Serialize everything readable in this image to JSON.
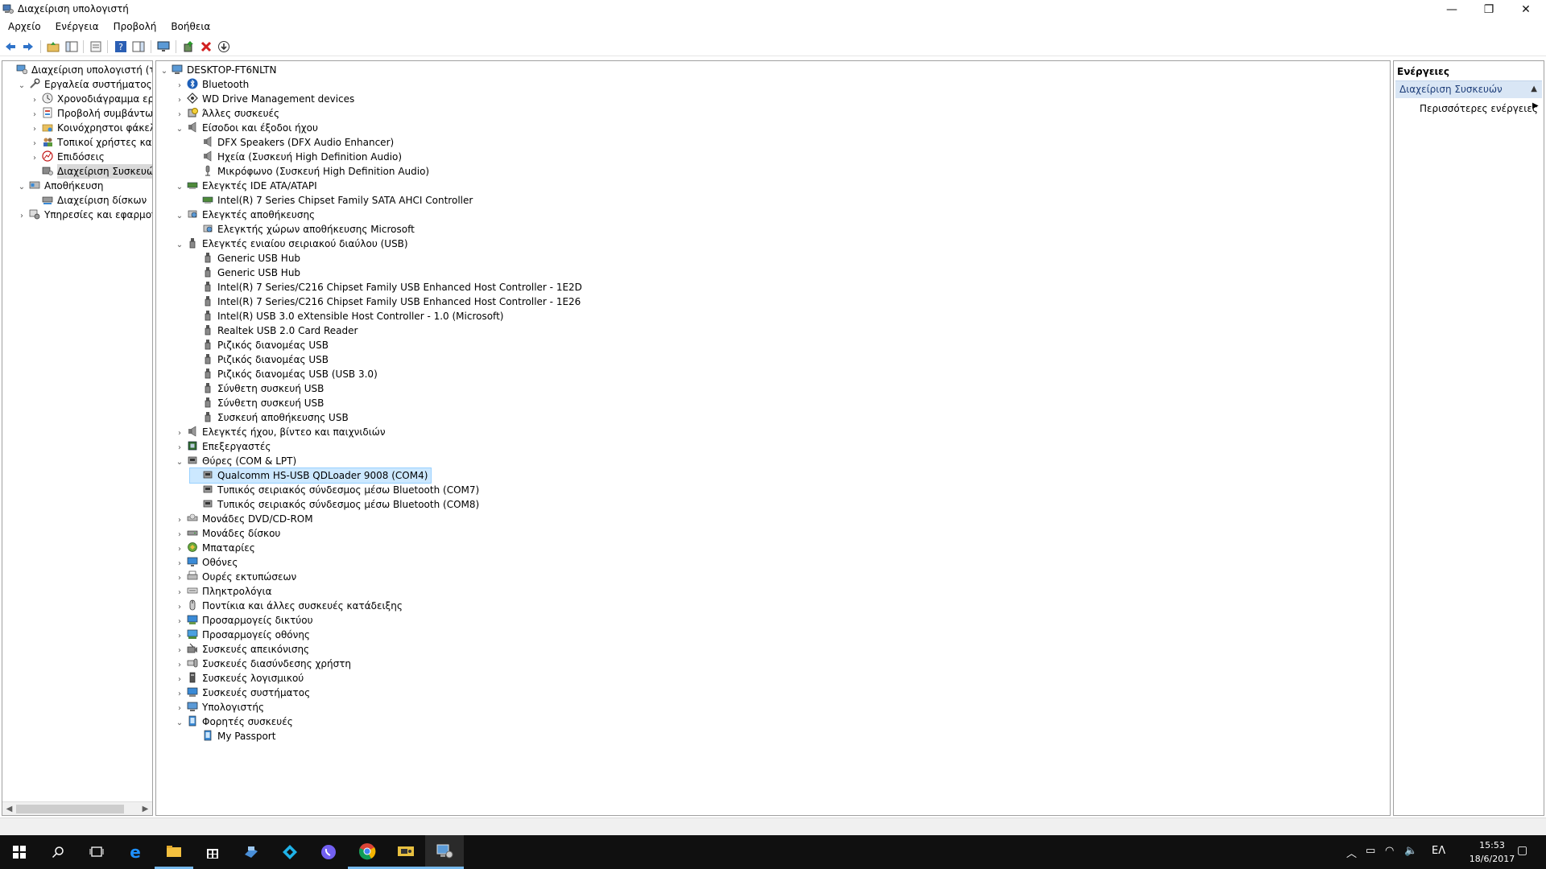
{
  "window": {
    "title": "Διαχείριση υπολογιστή",
    "minimize_glyph": "—",
    "maximize_glyph": "❐",
    "close_glyph": "✕"
  },
  "menu": [
    "Αρχείο",
    "Ενέργεια",
    "Προβολή",
    "Βοήθεια"
  ],
  "toolbar": {
    "icons": [
      "back-arrow-icon",
      "forward-arrow-icon",
      "folder-up-icon",
      "show-hide-tree-icon",
      "properties-icon",
      "help-icon",
      "action-pane-icon",
      "monitor-scan-icon",
      "update-driver-icon",
      "uninstall-icon",
      "download-icon"
    ]
  },
  "left_tree": {
    "items": [
      {
        "label": "Διαχείριση υπολογιστή (τοπικός)",
        "icon": "computer-management-icon",
        "indent": 0,
        "exp": ""
      },
      {
        "label": "Εργαλεία συστήματος",
        "icon": "tools-icon",
        "indent": 1,
        "exp": "v"
      },
      {
        "label": "Χρονοδιάγραμμα εργασιών",
        "icon": "clock-icon",
        "indent": 2,
        "exp": ">"
      },
      {
        "label": "Προβολή συμβάντων",
        "icon": "event-viewer-icon",
        "indent": 2,
        "exp": ">"
      },
      {
        "label": "Κοινόχρηστοι φάκελοι",
        "icon": "shared-folder-icon",
        "indent": 2,
        "exp": ">"
      },
      {
        "label": "Τοπικοί χρήστες και ομάδες",
        "icon": "users-icon",
        "indent": 2,
        "exp": ">"
      },
      {
        "label": "Επιδόσεις",
        "icon": "performance-icon",
        "indent": 2,
        "exp": ">"
      },
      {
        "label": "Διαχείριση Συσκευών",
        "icon": "device-manager-icon",
        "indent": 2,
        "exp": ""
      },
      {
        "label": "Αποθήκευση",
        "icon": "storage-icon",
        "indent": 1,
        "exp": "v"
      },
      {
        "label": "Διαχείριση δίσκων",
        "icon": "disk-management-icon",
        "indent": 2,
        "exp": ""
      },
      {
        "label": "Υπηρεσίες και εφαρμογές",
        "icon": "services-icon",
        "indent": 1,
        "exp": ">"
      }
    ]
  },
  "device_tree": {
    "items": [
      {
        "label": "DESKTOP-FT6NLTN",
        "icon": "computer-icon",
        "indent": 0,
        "exp": "v"
      },
      {
        "label": "Bluetooth",
        "icon": "bluetooth-icon",
        "indent": 1,
        "exp": ">"
      },
      {
        "label": "WD Drive Management devices",
        "icon": "wd-drive-icon",
        "indent": 1,
        "exp": ">"
      },
      {
        "label": "Άλλες συσκευές",
        "icon": "unknown-device-icon",
        "indent": 1,
        "exp": ">"
      },
      {
        "label": "Είσοδοι και έξοδοι ήχου",
        "icon": "speaker-icon",
        "indent": 1,
        "exp": "v"
      },
      {
        "label": "DFX Speakers (DFX Audio Enhancer)",
        "icon": "speaker-icon",
        "indent": 2,
        "exp": ""
      },
      {
        "label": "Ηχεία (Συσκευή High Definition Audio)",
        "icon": "speaker-icon",
        "indent": 2,
        "exp": ""
      },
      {
        "label": "Μικρόφωνο (Συσκευή High Definition Audio)",
        "icon": "microphone-icon",
        "indent": 2,
        "exp": ""
      },
      {
        "label": "Ελεγκτές IDE ATA/ATAPI",
        "icon": "ide-controller-icon",
        "indent": 1,
        "exp": "v"
      },
      {
        "label": "Intel(R) 7 Series Chipset Family SATA AHCI Controller",
        "icon": "ide-controller-icon",
        "indent": 2,
        "exp": ""
      },
      {
        "label": "Ελεγκτές αποθήκευσης",
        "icon": "storage-controller-icon",
        "indent": 1,
        "exp": "v"
      },
      {
        "label": "Ελεγκτής χώρων αποθήκευσης Microsoft",
        "icon": "storage-controller-icon",
        "indent": 2,
        "exp": ""
      },
      {
        "label": "Ελεγκτές ενιαίου σειριακού διαύλου (USB)",
        "icon": "usb-icon",
        "indent": 1,
        "exp": "v"
      },
      {
        "label": "Generic USB Hub",
        "icon": "usb-icon",
        "indent": 2,
        "exp": ""
      },
      {
        "label": "Generic USB Hub",
        "icon": "usb-icon",
        "indent": 2,
        "exp": ""
      },
      {
        "label": "Intel(R) 7 Series/C216 Chipset Family USB Enhanced Host Controller - 1E2D",
        "icon": "usb-icon",
        "indent": 2,
        "exp": ""
      },
      {
        "label": "Intel(R) 7 Series/C216 Chipset Family USB Enhanced Host Controller - 1E26",
        "icon": "usb-icon",
        "indent": 2,
        "exp": ""
      },
      {
        "label": "Intel(R) USB 3.0 eXtensible Host Controller - 1.0 (Microsoft)",
        "icon": "usb-icon",
        "indent": 2,
        "exp": ""
      },
      {
        "label": "Realtek USB 2.0 Card Reader",
        "icon": "usb-icon",
        "indent": 2,
        "exp": ""
      },
      {
        "label": "Ριζικός διανομέας USB",
        "icon": "usb-icon",
        "indent": 2,
        "exp": ""
      },
      {
        "label": "Ριζικός διανομέας USB",
        "icon": "usb-icon",
        "indent": 2,
        "exp": ""
      },
      {
        "label": "Ριζικός διανομέας USB (USB 3.0)",
        "icon": "usb-icon",
        "indent": 2,
        "exp": ""
      },
      {
        "label": "Σύνθετη συσκευή USB",
        "icon": "usb-icon",
        "indent": 2,
        "exp": ""
      },
      {
        "label": "Σύνθετη συσκευή USB",
        "icon": "usb-icon",
        "indent": 2,
        "exp": ""
      },
      {
        "label": "Συσκευή αποθήκευσης USB",
        "icon": "usb-icon",
        "indent": 2,
        "exp": ""
      },
      {
        "label": "Ελεγκτές ήχου, βίντεο και παιχνιδιών",
        "icon": "speaker-icon",
        "indent": 1,
        "exp": ">"
      },
      {
        "label": "Επεξεργαστές",
        "icon": "processor-icon",
        "indent": 1,
        "exp": ">"
      },
      {
        "label": "Θύρες (COM & LPT)",
        "icon": "port-icon",
        "indent": 1,
        "exp": "v"
      },
      {
        "label": "Qualcomm HS-USB QDLoader 9008 (COM4)",
        "icon": "port-icon",
        "indent": 2,
        "exp": "",
        "selected": true
      },
      {
        "label": "Τυπικός σειριακός σύνδεσμος μέσω Bluetooth (COM7)",
        "icon": "port-icon",
        "indent": 2,
        "exp": ""
      },
      {
        "label": "Τυπικός σειριακός σύνδεσμος μέσω Bluetooth (COM8)",
        "icon": "port-icon",
        "indent": 2,
        "exp": ""
      },
      {
        "label": "Μονάδες DVD/CD-ROM",
        "icon": "dvd-icon",
        "indent": 1,
        "exp": ">"
      },
      {
        "label": "Μονάδες δίσκου",
        "icon": "disk-drive-icon",
        "indent": 1,
        "exp": ">"
      },
      {
        "label": "Μπαταρίες",
        "icon": "battery-icon",
        "indent": 1,
        "exp": ">"
      },
      {
        "label": "Οθόνες",
        "icon": "monitor-icon",
        "indent": 1,
        "exp": ">"
      },
      {
        "label": "Ουρές εκτυπώσεων",
        "icon": "printer-icon",
        "indent": 1,
        "exp": ">"
      },
      {
        "label": "Πληκτρολόγια",
        "icon": "keyboard-icon",
        "indent": 1,
        "exp": ">"
      },
      {
        "label": "Ποντίκια και άλλες συσκευές κατάδειξης",
        "icon": "mouse-icon",
        "indent": 1,
        "exp": ">"
      },
      {
        "label": "Προσαρμογείς δικτύου",
        "icon": "network-adapter-icon",
        "indent": 1,
        "exp": ">"
      },
      {
        "label": "Προσαρμογείς οθόνης",
        "icon": "display-adapter-icon",
        "indent": 1,
        "exp": ">"
      },
      {
        "label": "Συσκευές απεικόνισης",
        "icon": "camera-icon",
        "indent": 1,
        "exp": ">"
      },
      {
        "label": "Συσκευές διασύνδεσης χρήστη",
        "icon": "hid-icon",
        "indent": 1,
        "exp": ">"
      },
      {
        "label": "Συσκευές λογισμικού",
        "icon": "software-device-icon",
        "indent": 1,
        "exp": ">"
      },
      {
        "label": "Συσκευές συστήματος",
        "icon": "system-device-icon",
        "indent": 1,
        "exp": ">"
      },
      {
        "label": "Υπολογιστής",
        "icon": "computer-icon",
        "indent": 1,
        "exp": ">"
      },
      {
        "label": "Φορητές συσκευές",
        "icon": "portable-device-icon",
        "indent": 1,
        "exp": "v"
      },
      {
        "label": "My Passport",
        "icon": "portable-device-icon",
        "indent": 2,
        "exp": ""
      }
    ]
  },
  "actions": {
    "title": "Ενέργειες",
    "section": "Διαχείριση Συσκευών",
    "more": "Περισσότερες ενέργειες"
  },
  "taskbar": {
    "apps": [
      "windows-start-icon",
      "search-icon",
      "task-view-icon",
      "edge-icon",
      "file-explorer-icon",
      "store-icon",
      "app-icon",
      "kodi-icon",
      "viber-icon",
      "chrome-icon",
      "app2-icon",
      "computer-management-icon"
    ],
    "language": "ΕΛ",
    "time": "15:53",
    "date": "18/6/2017"
  }
}
